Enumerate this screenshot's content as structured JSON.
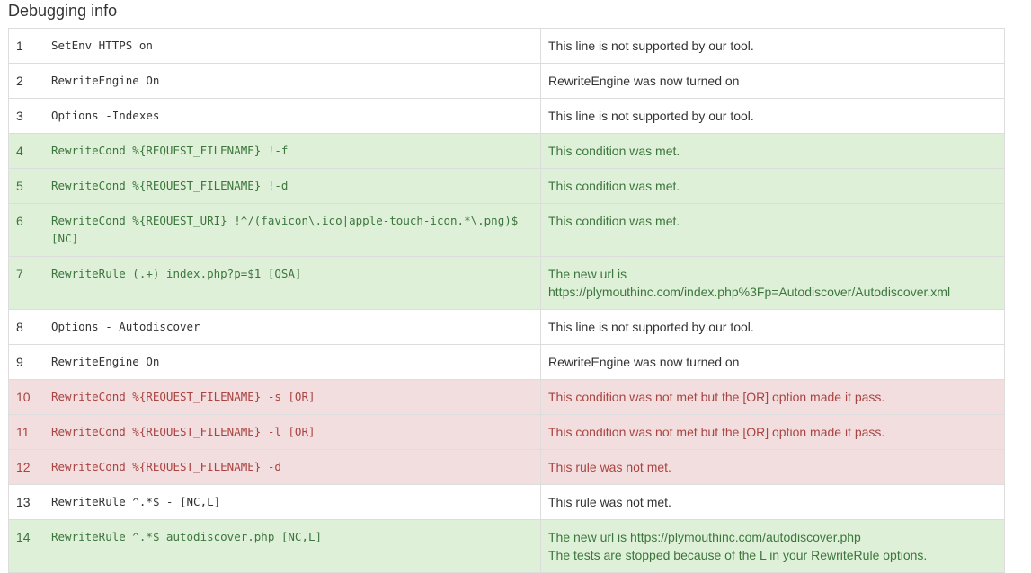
{
  "title": "Debugging info",
  "rows": [
    {
      "num": "1",
      "status": "neutral",
      "code": "SetEnv HTTPS on",
      "msg": [
        "This line is not supported by our tool."
      ]
    },
    {
      "num": "2",
      "status": "neutral",
      "code": "RewriteEngine On",
      "msg": [
        "RewriteEngine was now turned on"
      ]
    },
    {
      "num": "3",
      "status": "neutral",
      "code": "Options -Indexes",
      "msg": [
        "This line is not supported by our tool."
      ]
    },
    {
      "num": "4",
      "status": "ok",
      "code": "RewriteCond %{REQUEST_FILENAME} !-f",
      "msg": [
        "This condition was met."
      ]
    },
    {
      "num": "5",
      "status": "ok",
      "code": "RewriteCond %{REQUEST_FILENAME} !-d",
      "msg": [
        "This condition was met."
      ]
    },
    {
      "num": "6",
      "status": "ok",
      "code": "RewriteCond %{REQUEST_URI} !^/(favicon\\.ico|apple-touch-icon.*\\.png)$ [NC]",
      "msg": [
        "This condition was met."
      ]
    },
    {
      "num": "7",
      "status": "ok",
      "code": "RewriteRule (.+) index.php?p=$1 [QSA]",
      "msg": [
        "The new url is",
        "https://plymouthinc.com/index.php%3Fp=Autodiscover/Autodiscover.xml"
      ]
    },
    {
      "num": "8",
      "status": "neutral",
      "code": "Options - Autodiscover",
      "msg": [
        "This line is not supported by our tool."
      ]
    },
    {
      "num": "9",
      "status": "neutral",
      "code": "RewriteEngine On",
      "msg": [
        "RewriteEngine was now turned on"
      ]
    },
    {
      "num": "10",
      "status": "fail",
      "code": "RewriteCond %{REQUEST_FILENAME} -s [OR]",
      "msg": [
        "This condition was not met but the [OR] option made it pass."
      ]
    },
    {
      "num": "11",
      "status": "fail",
      "code": "RewriteCond %{REQUEST_FILENAME} -l [OR]",
      "msg": [
        "This condition was not met but the [OR] option made it pass."
      ]
    },
    {
      "num": "12",
      "status": "fail",
      "code": "RewriteCond %{REQUEST_FILENAME} -d",
      "msg": [
        "This rule was not met."
      ]
    },
    {
      "num": "13",
      "status": "neutral",
      "code": "RewriteRule ^.*$ - [NC,L]",
      "msg": [
        "This rule was not met."
      ]
    },
    {
      "num": "14",
      "status": "ok",
      "code": "RewriteRule ^.*$ autodiscover.php [NC,L]",
      "msg": [
        "The new url is https://plymouthinc.com/autodiscover.php",
        "The tests are stopped because of the L in your RewriteRule options."
      ]
    }
  ],
  "colors": {
    "ok_bg": "#dff0d8",
    "ok_text": "#3c763d",
    "fail_bg": "#f2dede",
    "fail_text": "#a94442",
    "border": "#dddddd"
  }
}
